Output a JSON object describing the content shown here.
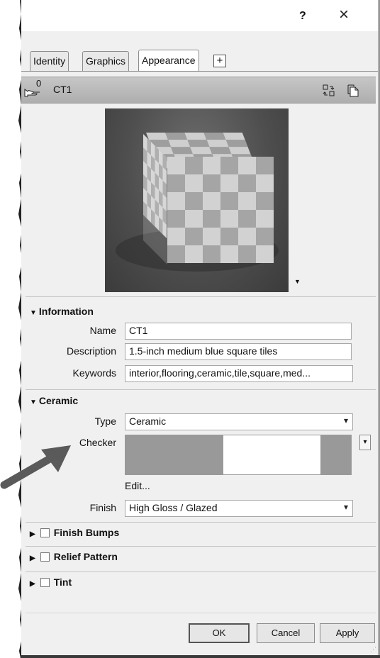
{
  "title_bar": {
    "help_label": "?",
    "close_label": "×"
  },
  "tabs": [
    {
      "label": "Identity",
      "active": false
    },
    {
      "label": "Graphics",
      "active": false
    },
    {
      "label": "Appearance",
      "active": true
    }
  ],
  "tab_add_label": "+",
  "asset": {
    "user_count": "0",
    "name": "CT1"
  },
  "information": {
    "header": "Information",
    "name_label": "Name",
    "name_value": "CT1",
    "description_label": "Description",
    "description_value": "1.5-inch medium blue square tiles",
    "keywords_label": "Keywords",
    "keywords_value": "interior,flooring,ceramic,tile,square,med..."
  },
  "ceramic": {
    "header": "Ceramic",
    "type_label": "Type",
    "type_value": "Ceramic",
    "checker_label": "Checker",
    "edit_link": "Edit...",
    "finish_label": "Finish",
    "finish_value": "High Gloss / Glazed"
  },
  "collapsed_sections": [
    {
      "label": "Finish Bumps"
    },
    {
      "label": "Relief Pattern"
    },
    {
      "label": "Tint"
    }
  ],
  "buttons": {
    "ok": "OK",
    "cancel": "Cancel",
    "apply": "Apply"
  },
  "colors": {
    "dialog_bg": "#f0f0f0",
    "header_gray": "#b8b8b8",
    "checker_gray": "#999999",
    "arrow_color": "#5a5a5a"
  }
}
